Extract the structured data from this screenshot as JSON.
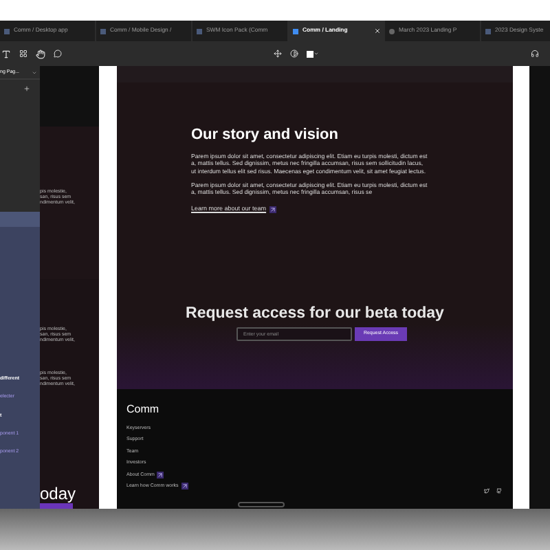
{
  "tabs": [
    {
      "label": "Comm / Desktop app",
      "kind": "file",
      "selected": false
    },
    {
      "label": "Comm / Mobile Design /",
      "kind": "file",
      "selected": false
    },
    {
      "label": "SWM Icon Pack (Comm",
      "kind": "file",
      "selected": false
    },
    {
      "label": "Comm / Landing",
      "kind": "file",
      "selected": true
    },
    {
      "label": "March 2023 Landing P",
      "kind": "site",
      "selected": false
    },
    {
      "label": "2023 Design Syste",
      "kind": "file",
      "selected": false
    }
  ],
  "layers_panel": {
    "page_name": "ng Pag...",
    "items": [
      {
        "label": "different",
        "kind": "heading"
      },
      {
        "label": "electer",
        "kind": "link"
      },
      {
        "label": "t",
        "kind": "heading"
      },
      {
        "label": "ponent 1",
        "kind": "link"
      },
      {
        "label": "ponent 2",
        "kind": "link"
      }
    ]
  },
  "side_frame": {
    "paragraphs": [
      [
        "pis molestie,",
        "san, risus sem",
        "ndimentum velit,"
      ],
      [
        "pis molestie,",
        "san, risus sem",
        "ndimentum velit,"
      ],
      [
        "pis molestie,",
        "san, risus sem",
        "ndimentum velit,"
      ]
    ],
    "heading": "oday"
  },
  "landing": {
    "story": {
      "title": "Our story and vision",
      "paragraphs": [
        "Parem ipsum dolor sit amet, consectetur adipiscing elit. Etiam eu turpis molesti, dictum est a, mattis tellus. Sed dignissim, metus nec fringilla accumsan, risus sem sollicitudin lacus, ut interdum tellus elit sed risus. Maecenas eget condimentum velit, sit amet feugiat lectus.",
        "Parem ipsum dolor sit amet, consectetur adipiscing elit. Etiam eu turpis molesti, dictum est a, mattis tellus. Sed dignissim, metus nec fringilla accumsan, risus se"
      ],
      "link": "Learn more about our team"
    },
    "beta": {
      "title": "Request access for our beta today",
      "placeholder": "Enter your email",
      "button": "Request Access"
    },
    "footer": {
      "brand": "Comm",
      "links": [
        {
          "label": "Keyservers",
          "external": false
        },
        {
          "label": "Support",
          "external": false
        },
        {
          "label": "Team",
          "external": false
        },
        {
          "label": "Investors",
          "external": false
        },
        {
          "label": "About Comm",
          "external": true
        },
        {
          "label": "Learn how Comm works",
          "external": true
        }
      ]
    }
  }
}
